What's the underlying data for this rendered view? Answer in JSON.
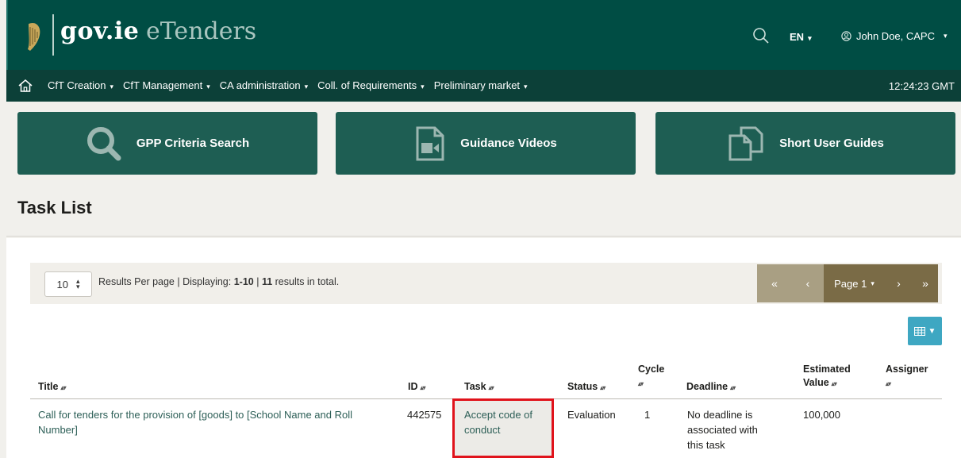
{
  "header": {
    "logo_gov": "gov.ie",
    "logo_app": "eTenders",
    "language": "EN",
    "user": "John Doe, CAPC"
  },
  "nav": {
    "items": [
      {
        "label": "CfT Creation"
      },
      {
        "label": "CfT Management"
      },
      {
        "label": "CA administration"
      },
      {
        "label": "Coll. of Requirements"
      },
      {
        "label": "Preliminary market"
      }
    ],
    "clock": "12:24:23 GMT"
  },
  "tiles": [
    {
      "label": "GPP Criteria Search",
      "icon": "search-icon"
    },
    {
      "label": "Guidance Videos",
      "icon": "video-file-icon"
    },
    {
      "label": "Short User Guides",
      "icon": "documents-icon"
    }
  ],
  "page_title": "Task List",
  "results": {
    "per_page": "10",
    "text_prefix": "Results Per page | Displaying: ",
    "range": "1-10",
    "sep": " | ",
    "total": "11",
    "text_suffix": " results in total."
  },
  "pager": {
    "first": "«",
    "prev": "‹",
    "page_label": "Page 1",
    "next": "›",
    "last": "»"
  },
  "table": {
    "headers": {
      "title": "Title",
      "id": "ID",
      "task": "Task",
      "status": "Status",
      "cycle": "Cycle",
      "deadline": "Deadline",
      "estimated_value": "Estimated Value",
      "estimated_value_line1": "Estimated",
      "estimated_value_line2": "Value",
      "assigner": "Assigner"
    },
    "rows": [
      {
        "title_line1": "Call for tenders for the provision of [goods] to [School Name and Roll",
        "title_line2": "Number]",
        "id": "442575",
        "task_line1": "Accept code of",
        "task_line2": "conduct",
        "status": "Evaluation",
        "cycle": "1",
        "deadline_line1": "No deadline is",
        "deadline_line2": "associated with",
        "deadline_line3": "this task",
        "estimated_value": "100,000",
        "assigner": ""
      }
    ]
  },
  "colors": {
    "header_bg": "#004d44",
    "nav_bg": "#0c4038",
    "tile_bg": "#1e5e53",
    "pager_light": "#a99f83",
    "pager_dark": "#7a6b46",
    "column_button": "#3ea7c2",
    "highlight": "#e0131b"
  }
}
